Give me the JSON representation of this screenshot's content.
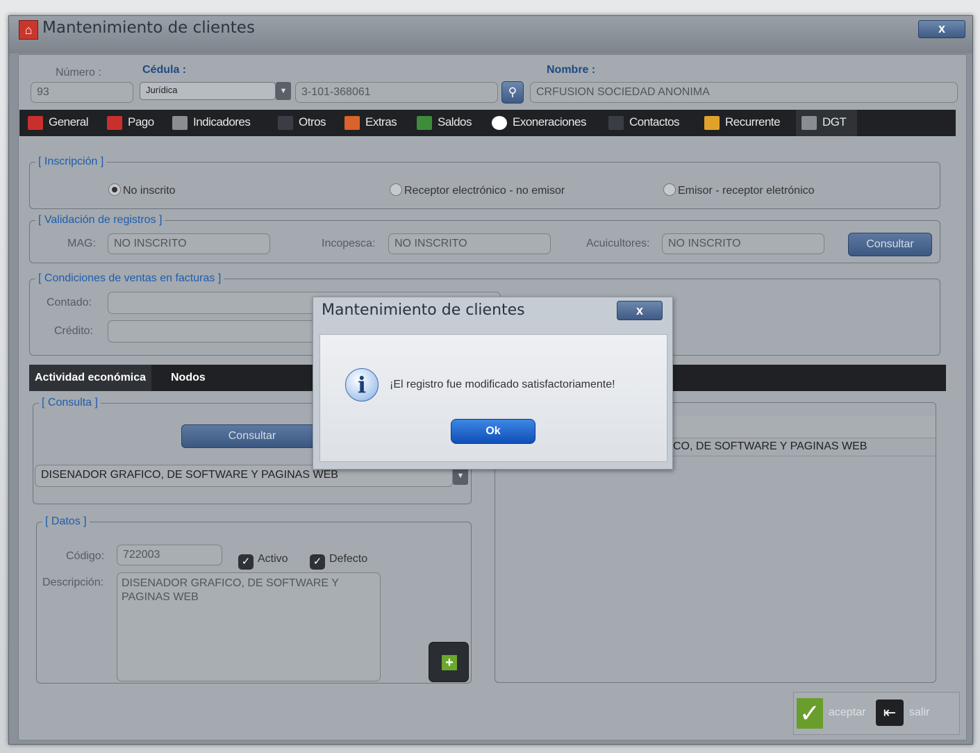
{
  "window": {
    "title": "Mantenimiento de clientes",
    "close_label": "x"
  },
  "header": {
    "numero_label": "Número :",
    "numero_value": "93",
    "cedula_label": "Cédula :",
    "cedula_type": "Jurídica",
    "cedula_value": "3-101-368061",
    "nombre_label": "Nombre :",
    "nombre_value": "CRFUSION SOCIEDAD ANONIMA"
  },
  "tabs": [
    {
      "label": "General",
      "icon": "calendar-icon",
      "color": "#c9302c"
    },
    {
      "label": "Pago",
      "icon": "shuffle-icon",
      "color": "#c9302c"
    },
    {
      "label": "Indicadores",
      "icon": "gear-icon",
      "color": "#8a8e93"
    },
    {
      "label": "Otros",
      "icon": "list-icon",
      "color": "#3a3e44"
    },
    {
      "label": "Extras",
      "icon": "list-icon",
      "color": "#d9632a"
    },
    {
      "label": "Saldos",
      "icon": "calculator-icon",
      "color": "#3d8c3a"
    },
    {
      "label": "Exoneraciones",
      "icon": "alert-icon",
      "color": "#ffffff"
    },
    {
      "label": "Contactos",
      "icon": "user-icon",
      "color": "#3a3e44"
    },
    {
      "label": "Recurrente",
      "icon": "cart-icon",
      "color": "#e0a22a"
    },
    {
      "label": "DGT",
      "icon": "gear-icon",
      "color": "#8a8e93"
    }
  ],
  "inscripcion": {
    "legend": "[ Inscripción ]",
    "options": [
      "No inscrito",
      "Receptor electrónico - no emisor",
      "Emisor - receptor eletrónico"
    ],
    "selected": "No inscrito"
  },
  "validacion": {
    "legend": "[ Validación de registros ]",
    "mag_label": "MAG:",
    "mag_value": "NO INSCRITO",
    "incopesca_label": "Incopesca:",
    "incopesca_value": "NO INSCRITO",
    "acuicultores_label": "Acuicultores:",
    "acuicultores_value": "NO INSCRITO",
    "consultar_label": "Consultar"
  },
  "condiciones": {
    "legend": "[ Condiciones de ventas en facturas ]",
    "contado_label": "Contado:",
    "credito_label": "Crédito:"
  },
  "actividad": {
    "tab1": "Actividad económica",
    "tab2": "Nodos",
    "consulta_legend": "[ Consulta ]",
    "consultar_label": "Consultar",
    "selected_activity": "DISENADOR GRAFICO, DE SOFTWARE Y PAGINAS WEB",
    "datos_legend": "[ Datos ]",
    "codigo_label": "Código:",
    "codigo_value": "722003",
    "activo_label": "Activo",
    "defecto_label": "Defecto",
    "descripcion_label": "Descripción:",
    "descripcion_value": "DISENADOR GRAFICO, DE SOFTWARE Y PAGINAS WEB",
    "grid_row": "CO, DE SOFTWARE Y PAGINAS WEB"
  },
  "footer": {
    "aceptar": "aceptar",
    "salir": "salir"
  },
  "modal": {
    "title": "Mantenimiento de clientes",
    "close_label": "x",
    "message": "¡El registro fue modificado satisfactoriamente!",
    "ok_label": "Ok",
    "icon": "info-icon"
  }
}
